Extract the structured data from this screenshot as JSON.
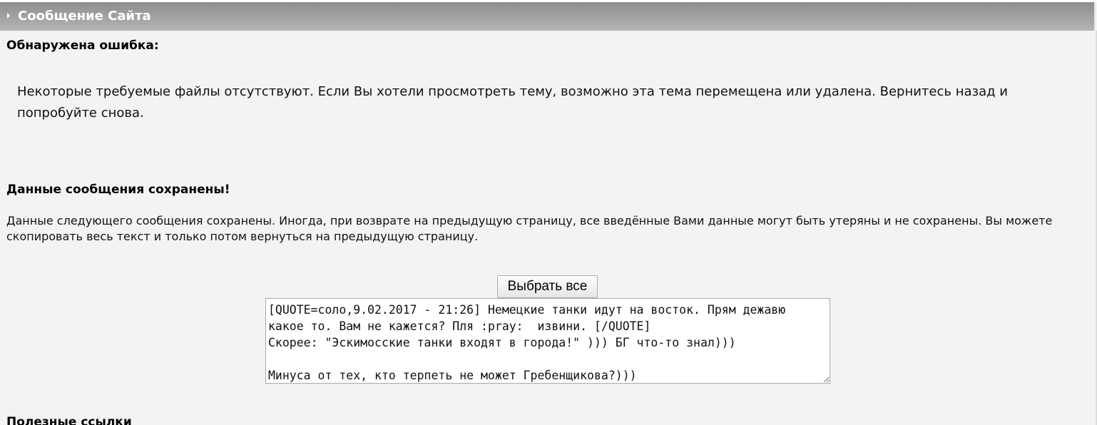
{
  "header": {
    "title": "Сообщение Сайта"
  },
  "error": {
    "heading": "Обнаружена ошибка:",
    "text": "Некоторые требуемые файлы отсутствуют. Если Вы хотели просмотреть тему, возможно эта тема перемещена или удалена. Вернитесь назад и попробуйте снова."
  },
  "saved": {
    "heading": "Данные сообщения сохранены!",
    "text": "Данные следующего сообщения сохранены. Иногда, при возврате на предыдущую страницу, все введённые Вами данные могут быть утеряны и не сохранены. Вы можете скопировать весь текст и только потом вернуться на предыдущую страницу.",
    "select_all_label": "Выбрать все",
    "message": "[QUOTE=соло,9.02.2017 - 21:26] Немецкие танки идут на восток. Прям дежавю какое то. Вам не кажется? Пля :pray:  извини. [/QUOTE]\nСкорее: \"Эскимосские танки входят в города!\" ))) БГ что-то знал)))\n\nМинуса от тех, кто терпеть не может Гребенщикова?)))"
  },
  "links": {
    "heading": "Полезные ссылки"
  },
  "colors": {
    "header_gradient_top": "#8e8e8e",
    "header_gradient_bottom": "#b4b4b4",
    "page_background": "#f3f3f3"
  },
  "icons": {
    "header_marker": "triangle-right-icon"
  }
}
